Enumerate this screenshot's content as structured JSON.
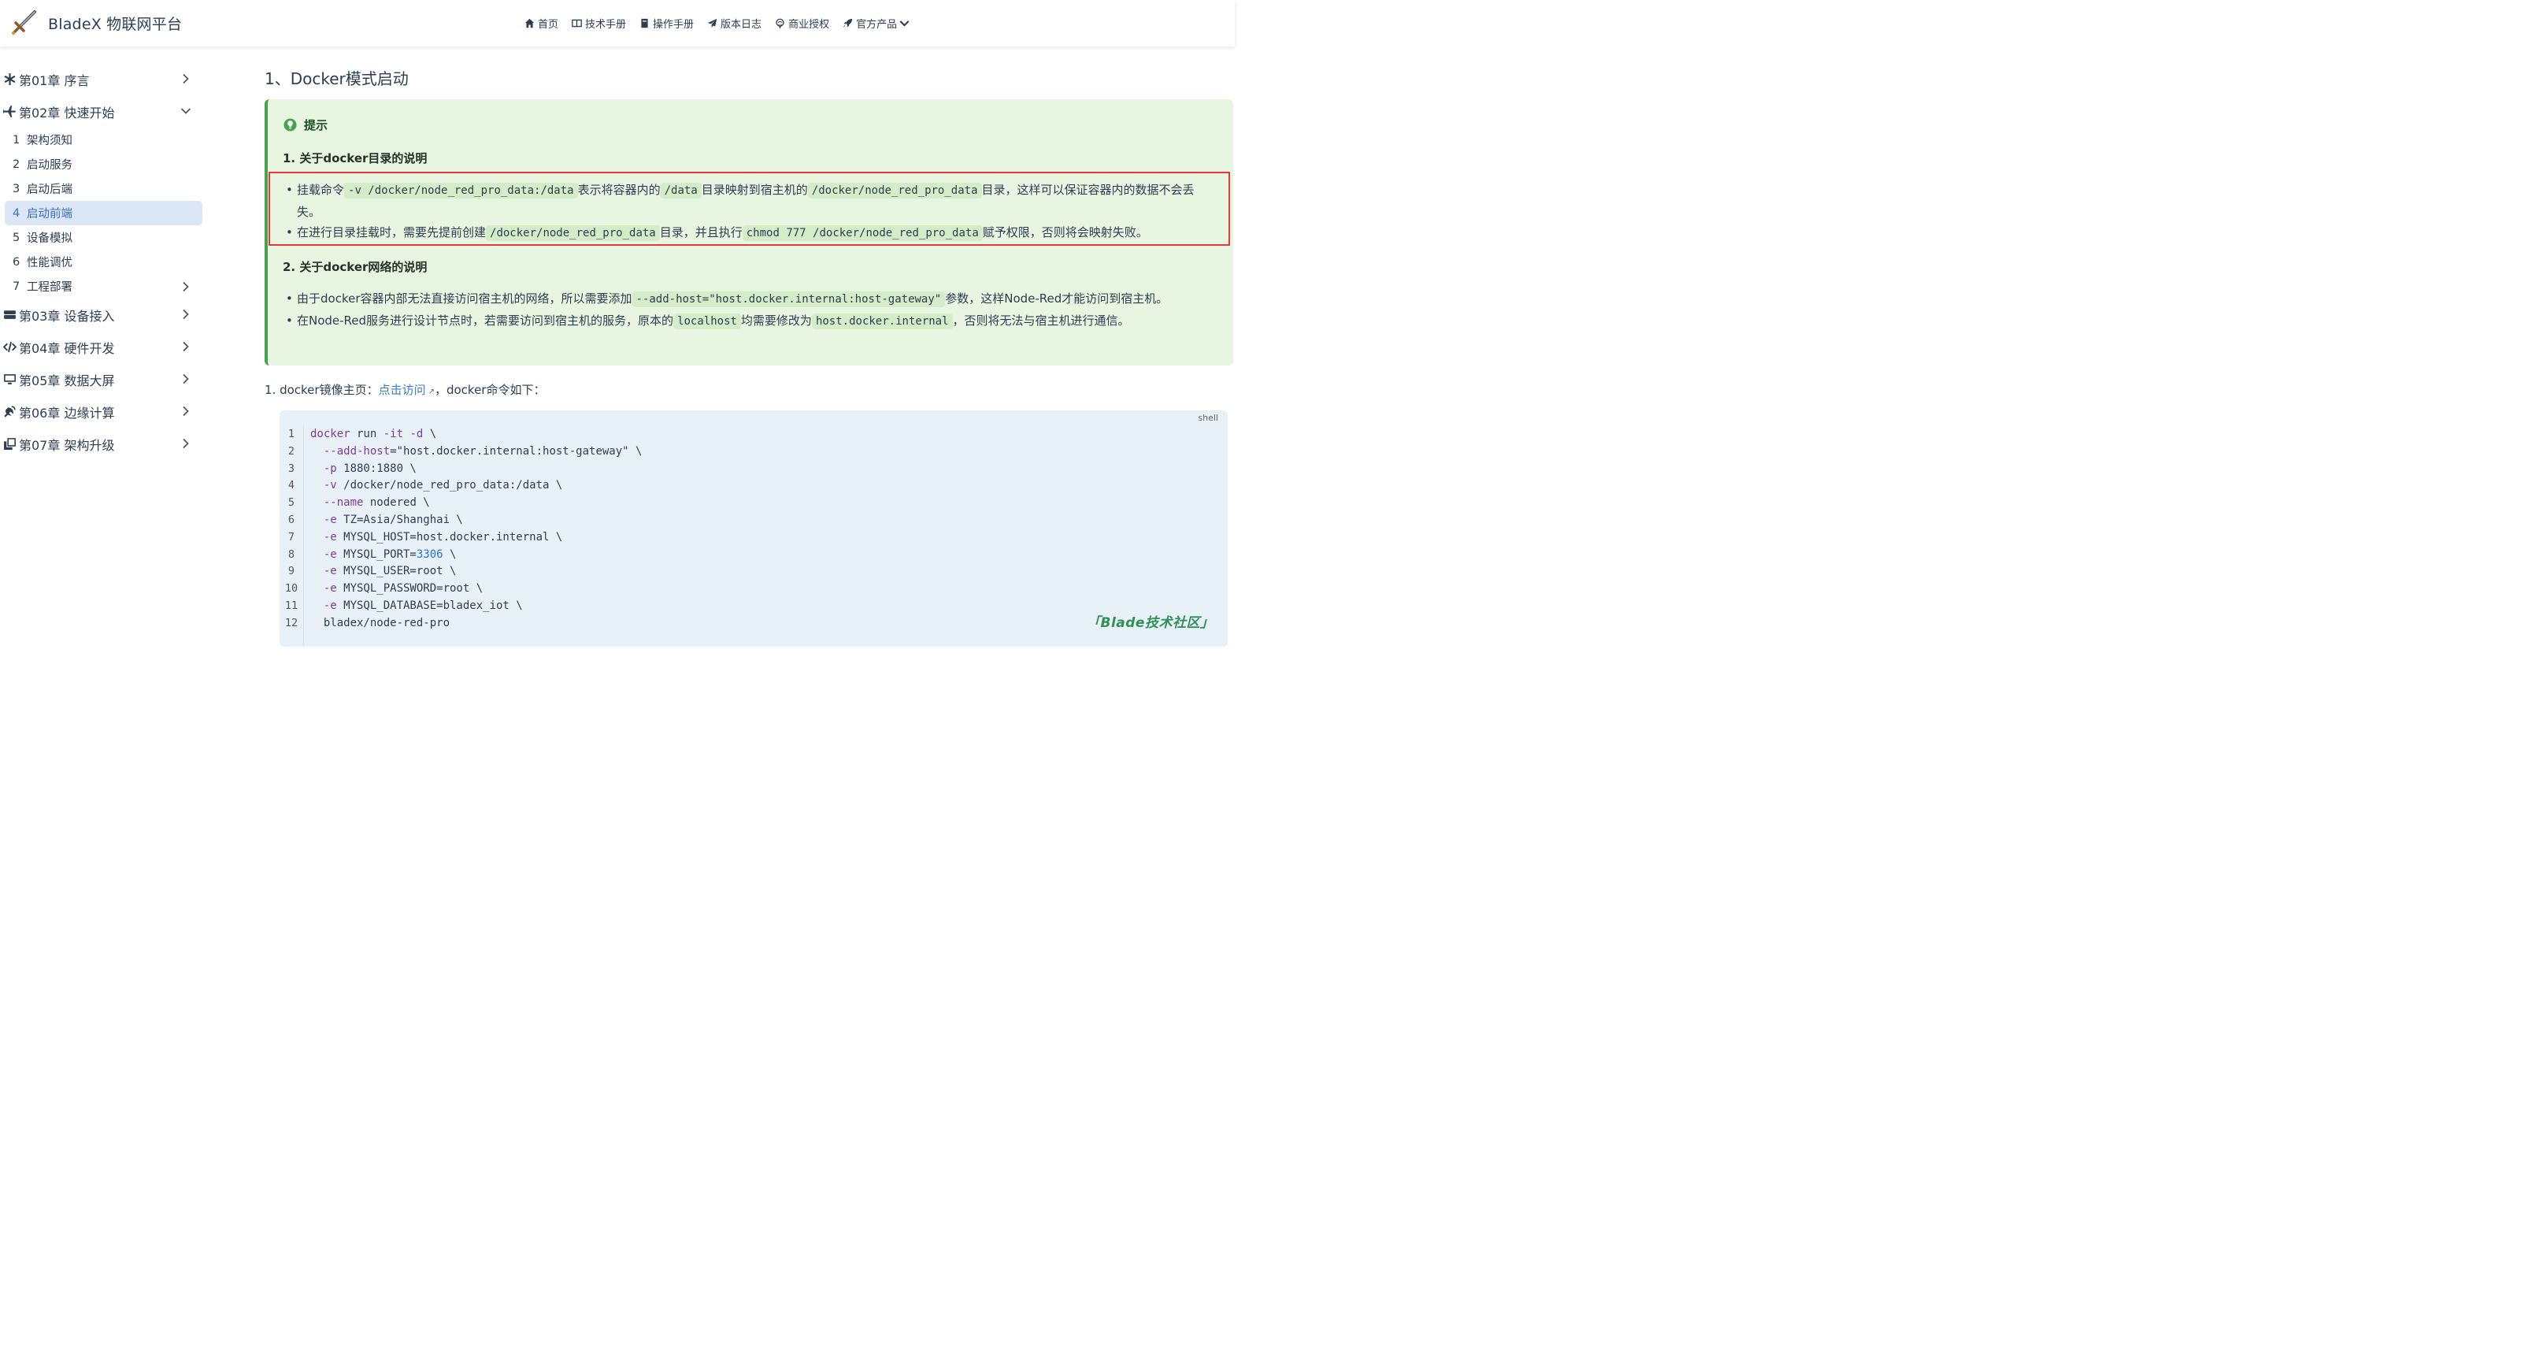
{
  "header": {
    "brand": "BladeX 物联网平台",
    "nav": [
      {
        "icon": "home-icon",
        "label": "首页"
      },
      {
        "icon": "book-icon",
        "label": "技术手册"
      },
      {
        "icon": "manual-icon",
        "label": "操作手册"
      },
      {
        "icon": "paper-plane-icon",
        "label": "版本日志"
      },
      {
        "icon": "license-icon",
        "label": "商业授权"
      },
      {
        "icon": "rocket-icon",
        "label": "官方产品"
      }
    ]
  },
  "sidebar": {
    "chapters": [
      {
        "icon": "asterisk-icon",
        "label": "第01章 序言",
        "expanded": false
      },
      {
        "icon": "plane-icon",
        "label": "第02章 快速开始",
        "expanded": true
      },
      {
        "icon": "server-icon",
        "label": "第03章 设备接入",
        "expanded": false
      },
      {
        "icon": "code-icon",
        "label": "第04章 硬件开发",
        "expanded": false
      },
      {
        "icon": "monitor-icon",
        "label": "第05章 数据大屏",
        "expanded": false
      },
      {
        "icon": "satellite-icon",
        "label": "第06章 边缘计算",
        "expanded": false
      },
      {
        "icon": "copy-icon",
        "label": "第07章 架构升级",
        "expanded": false
      }
    ],
    "sub_items": [
      {
        "num": "1",
        "label": "架构须知"
      },
      {
        "num": "2",
        "label": "启动服务"
      },
      {
        "num": "3",
        "label": "启动后端"
      },
      {
        "num": "4",
        "label": "启动前端",
        "active": true
      },
      {
        "num": "5",
        "label": "设备模拟"
      },
      {
        "num": "6",
        "label": "性能调优"
      },
      {
        "num": "7",
        "label": "工程部署"
      }
    ]
  },
  "main": {
    "heading": "1、Docker模式启动",
    "tip": {
      "title": "提示",
      "section1": "1. 关于docker目录的说明",
      "section2": "2. 关于docker网络的说明",
      "s1_b1_t1": "挂载命令",
      "s1_b1_c1": "-v /docker/node_red_pro_data:/data",
      "s1_b1_t2": "表示将容器内的",
      "s1_b1_c2": "/data",
      "s1_b1_t3": "目录映射到宿主机的",
      "s1_b1_c3": "/docker/node_red_pro_data",
      "s1_b1_t4": "目录，这样可以保证容器内的数据不会丢失。",
      "s1_b2_t1": "在进行目录挂载时，需要先提前创建",
      "s1_b2_c1": "/docker/node_red_pro_data",
      "s1_b2_t2": "目录，并且执行",
      "s1_b2_c2": "chmod 777 /docker/node_red_pro_data",
      "s1_b2_t3": "赋予权限，否则将会映射失败。",
      "s2_b1_t1": "由于docker容器内部无法直接访问宿主机的网络，所以需要添加",
      "s2_b1_c1": "--add-host=\"host.docker.internal:host-gateway\"",
      "s2_b1_t2": "参数，这样Node-Red才能访问到宿主机。",
      "s2_b2_t1": "在Node-Red服务进行设计节点时，若需要访问到宿主机的服务，原本的",
      "s2_b2_c1": "localhost",
      "s2_b2_t2": "均需要修改为",
      "s2_b2_c2": "host.docker.internal",
      "s2_b2_t3": "，否则将无法与宿主机进行通信。"
    },
    "para_prefix": "1. docker镜像主页：",
    "para_link": "点击访问",
    "para_suffix": "，docker命令如下：",
    "code": {
      "lang": "shell",
      "line_numbers": [
        "1",
        "2",
        "3",
        "4",
        "5",
        "6",
        "7",
        "8",
        "9",
        "10",
        "11",
        "12"
      ],
      "lines": [
        "docker run -it -d \\",
        "  --add-host=\"host.docker.internal:host-gateway\" \\",
        "  -p 1880:1880 \\",
        "  -v /docker/node_red_pro_data:/data \\",
        "  --name nodered \\",
        "  -e TZ=Asia/Shanghai \\",
        "  -e MYSQL_HOST=host.docker.internal \\",
        "  -e MYSQL_PORT=3306 \\",
        "  -e MYSQL_USER=root \\",
        "  -e MYSQL_PASSWORD=root \\",
        "  -e MYSQL_DATABASE=bladex_iot \\",
        "  bladex/node-red-pro"
      ]
    },
    "watermark": "Blade技术社区"
  },
  "colors": {
    "accent": "#3a7bd5",
    "tip_bg": "#e8f5e0",
    "tip_border": "#46a34c",
    "highlight_box": "#e03a3a",
    "active_bg": "#dbe6f6"
  }
}
